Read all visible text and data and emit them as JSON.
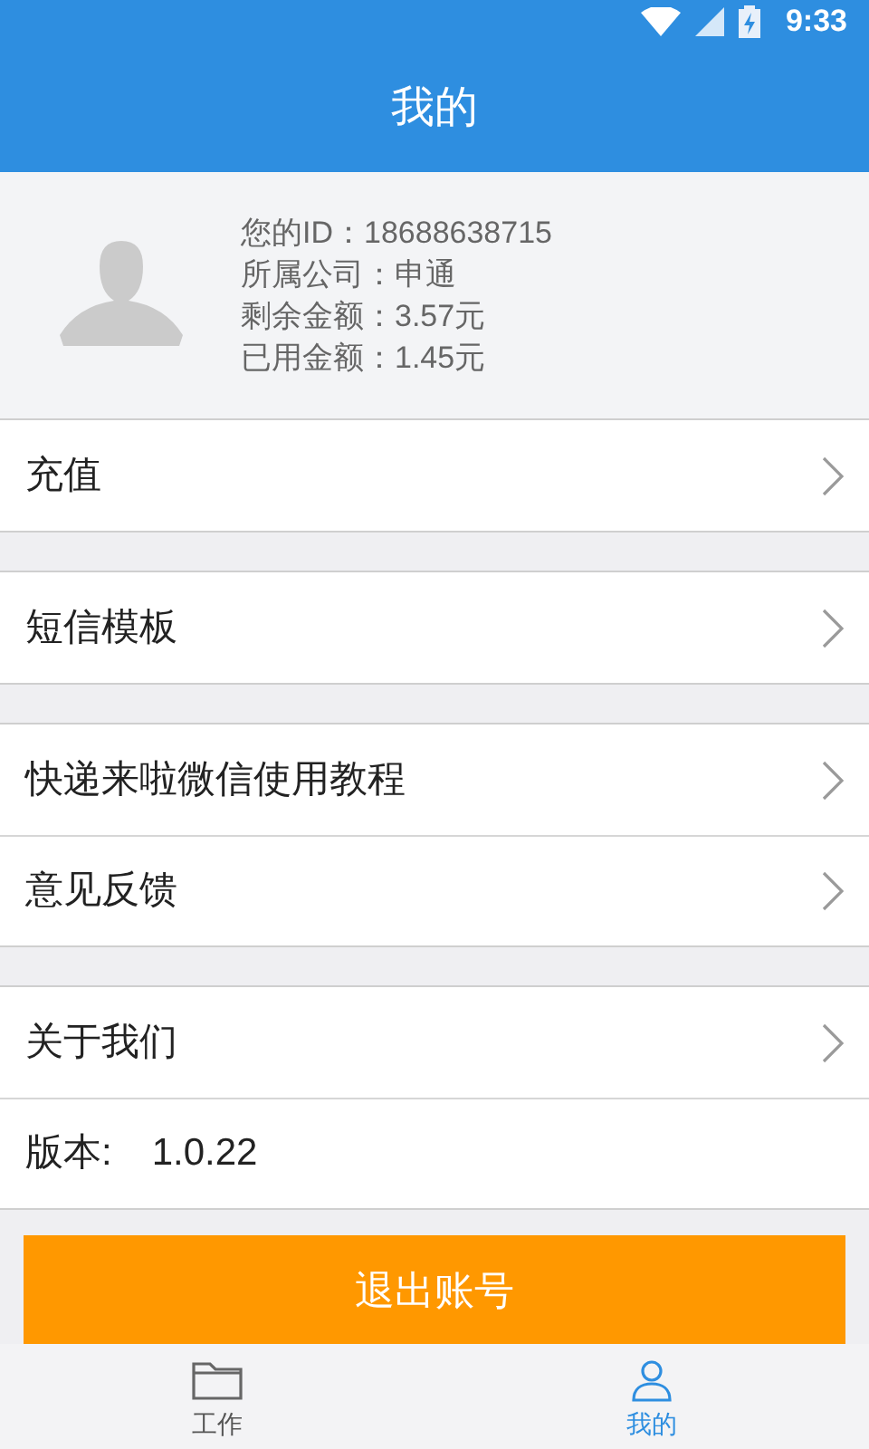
{
  "status_bar": {
    "time": "9:33"
  },
  "header": {
    "title": "我的"
  },
  "profile": {
    "lines": [
      "您的ID：18688638715",
      "所属公司：申通",
      "剩余金额：3.57元",
      "已用金额：1.45元"
    ]
  },
  "groups": [
    [
      {
        "kind": "link",
        "label": "充值"
      }
    ],
    [
      {
        "kind": "link",
        "label": "短信模板"
      }
    ],
    [
      {
        "kind": "link",
        "label": "快递来啦微信使用教程"
      },
      {
        "kind": "link",
        "label": "意见反馈"
      }
    ],
    [
      {
        "kind": "link",
        "label": "关于我们"
      },
      {
        "kind": "info",
        "label": "版本:",
        "value": "1.0.22"
      }
    ]
  ],
  "logout_button": "退出账号",
  "bottom_nav": [
    {
      "label": "工作",
      "kind": "folder",
      "selected": false
    },
    {
      "label": "我的",
      "kind": "person",
      "selected": true
    }
  ]
}
